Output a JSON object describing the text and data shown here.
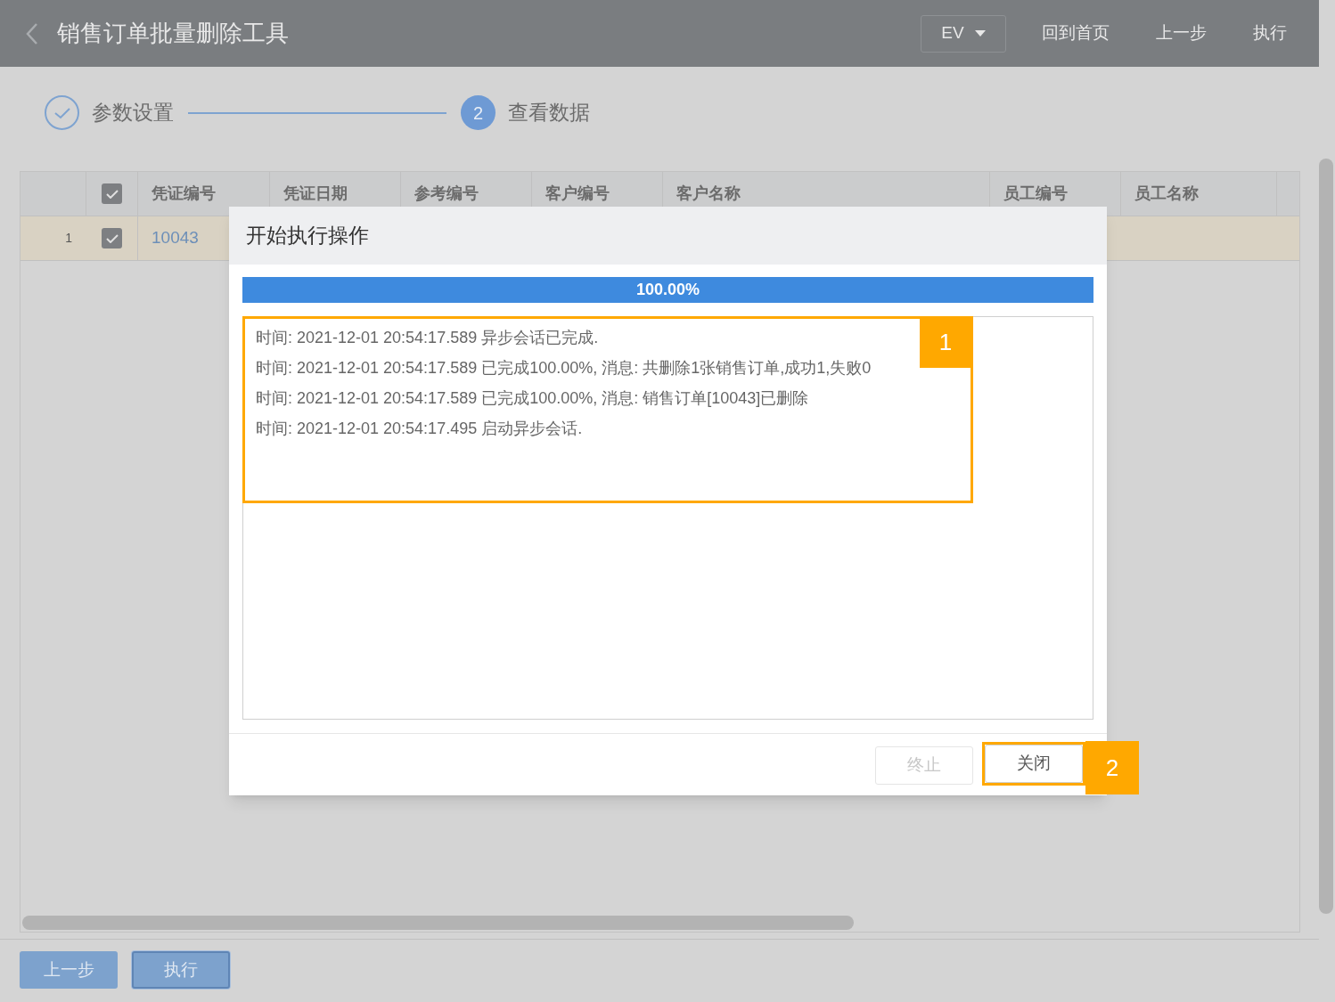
{
  "header": {
    "title": "销售订单批量删除工具",
    "env": "EV",
    "actions": [
      "回到首页",
      "上一步",
      "执行"
    ]
  },
  "steps": [
    {
      "label": "参数设置",
      "done": true
    },
    {
      "label": "查看数据",
      "done": false,
      "number": "2"
    }
  ],
  "table": {
    "all_checked": true,
    "columns": [
      "凭证编号",
      "凭证日期",
      "参考编号",
      "客户编号",
      "客户名称",
      "员工编号",
      "员工名称"
    ],
    "rows": [
      {
        "number": "1",
        "checked": true,
        "voucher": "10043"
      }
    ]
  },
  "footer": {
    "buttons": [
      {
        "label": "上一步",
        "selected": false
      },
      {
        "label": "执行",
        "selected": true
      }
    ]
  },
  "dialog": {
    "title": "开始执行操作",
    "progress": {
      "level": 1,
      "text": "100.00%"
    },
    "log": [
      "时间: 2021-12-01 20:54:17.589 异步会话已完成.",
      "时间: 2021-12-01 20:54:17.589 已完成100.00%, 消息: 共删除1张销售订单,成功1,失败0",
      "时间: 2021-12-01 20:54:17.589 已完成100.00%, 消息: 销售订单[10043]已删除",
      "时间: 2021-12-01 20:54:17.495 启动异步会话."
    ],
    "buttons": [
      {
        "label": "终止",
        "disabled": true
      },
      {
        "label": "关闭",
        "disabled": false
      }
    ]
  },
  "callouts": [
    "1",
    "2"
  ]
}
